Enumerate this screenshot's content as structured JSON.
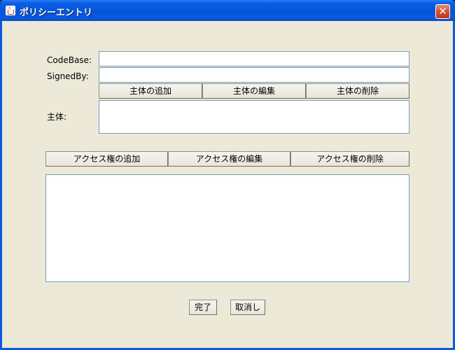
{
  "window": {
    "title": "ポリシーエントリ",
    "close_glyph": "✕"
  },
  "form": {
    "codebase_label": "CodeBase:",
    "codebase_value": "",
    "signedby_label": "SignedBy:",
    "signedby_value": "",
    "principal_buttons": [
      "主体の追加",
      "主体の編集",
      "主体の削除"
    ],
    "principal_label": "主体:",
    "principal_items": []
  },
  "permissions": {
    "buttons": [
      "アクセス権の追加",
      "アクセス権の編集",
      "アクセス権の削除"
    ],
    "items": []
  },
  "footer": {
    "done": "完了",
    "cancel": "取消し"
  },
  "colors": {
    "titlebar": "#0654d8",
    "dialog_bg": "#ece9d8",
    "field_border": "#7f9db9",
    "close_button": "#d1462b"
  }
}
